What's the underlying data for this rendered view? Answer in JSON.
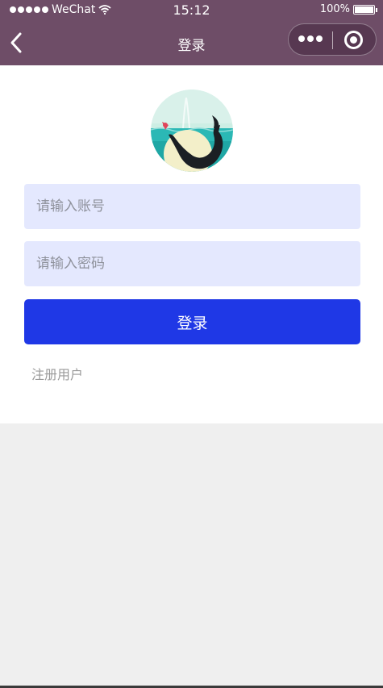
{
  "status_bar": {
    "carrier": "WeChat",
    "time": "15:12",
    "battery": "100%"
  },
  "nav": {
    "title": "登录",
    "back_icon": "chevron-left-icon",
    "more_icon": "more-dots-icon",
    "close_icon": "target-circle-icon"
  },
  "form": {
    "account_placeholder": "请输入账号",
    "password_placeholder": "请输入密码",
    "login_label": "登录",
    "register_link": "注册用户"
  },
  "colors": {
    "header": "#6e4d67",
    "input_bg": "#e4e8fe",
    "button": "#1f38e6",
    "page_bg": "#efefef"
  }
}
